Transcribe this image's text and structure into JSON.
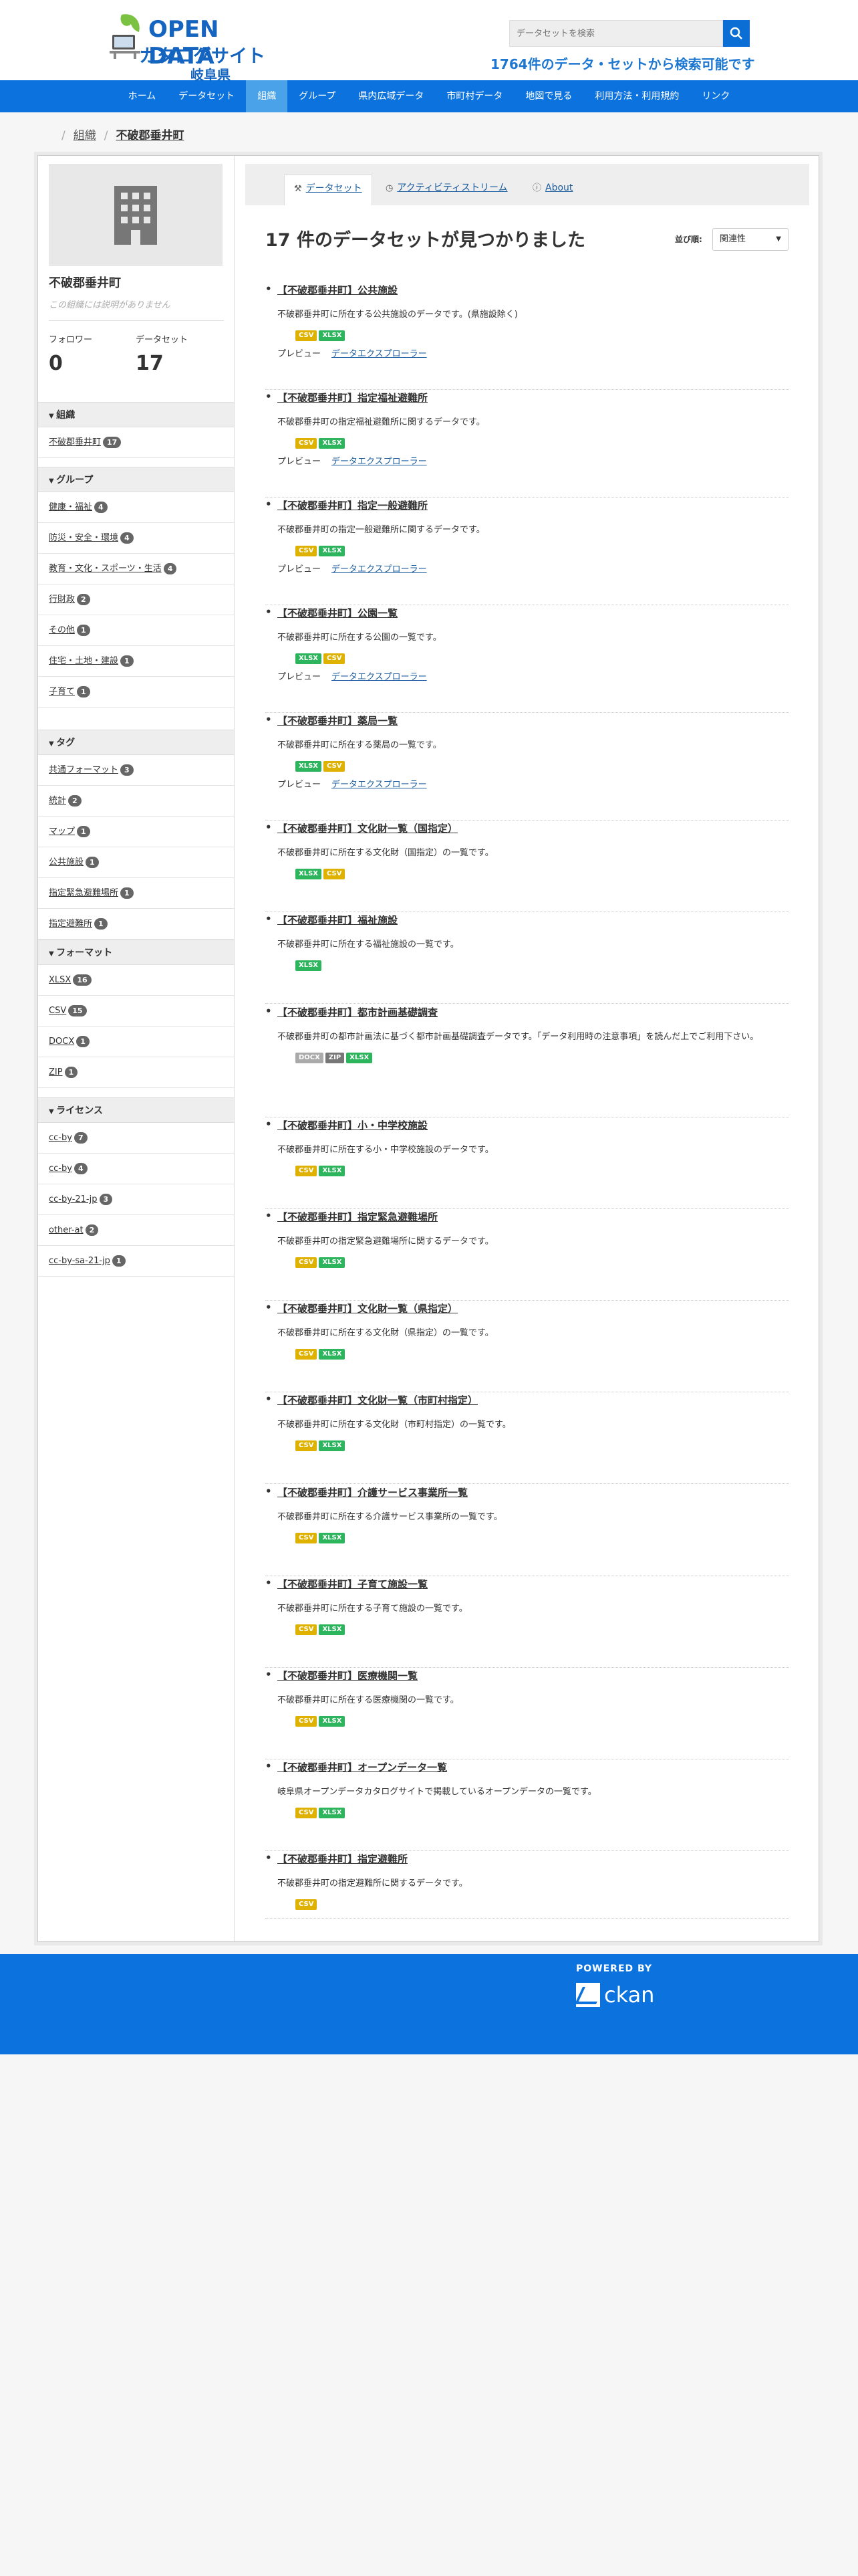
{
  "header": {
    "logo_line1": "OPEN DATA",
    "logo_line2": "カタログサイト",
    "logo_line3": "岐阜県",
    "search_placeholder": "データセットを検索",
    "tagline": "1764件のデータ・セットから検索可能です"
  },
  "nav": [
    "ホーム",
    "データセット",
    "組織",
    "グループ",
    "県内広域データ",
    "市町村データ",
    "地図で見る",
    "利用方法・利用規約",
    "リンク"
  ],
  "nav_active": "組織",
  "breadcrumb": {
    "parent": "組織",
    "current": "不破郡垂井町"
  },
  "org": {
    "name": "不破郡垂井町",
    "description": "この組織には説明がありません",
    "followers_label": "フォロワー",
    "followers": "0",
    "datasets_label": "データセット",
    "datasets": "17"
  },
  "facets": {
    "org": {
      "title": "組織",
      "items": [
        {
          "label": "不破郡垂井町",
          "count": "17"
        }
      ]
    },
    "groups": {
      "title": "グループ",
      "items": [
        {
          "label": "健康・福祉",
          "count": "4"
        },
        {
          "label": "防災・安全・環境",
          "count": "4"
        },
        {
          "label": "教育・文化・スポーツ・生活",
          "count": "4"
        },
        {
          "label": "行財政",
          "count": "2"
        },
        {
          "label": "その他",
          "count": "1"
        },
        {
          "label": "住宅・土地・建設",
          "count": "1"
        },
        {
          "label": "子育て",
          "count": "1"
        }
      ]
    },
    "tags": {
      "title": "タグ",
      "items": [
        {
          "label": "共通フォーマット",
          "count": "3"
        },
        {
          "label": "統計",
          "count": "2"
        },
        {
          "label": "マップ",
          "count": "1"
        },
        {
          "label": "公共施設",
          "count": "1"
        },
        {
          "label": "指定緊急避難場所",
          "count": "1"
        },
        {
          "label": "指定避難所",
          "count": "1"
        }
      ]
    },
    "formats": {
      "title": "フォーマット",
      "items": [
        {
          "label": "XLSX",
          "count": "16"
        },
        {
          "label": "CSV",
          "count": "15"
        },
        {
          "label": "DOCX",
          "count": "1"
        },
        {
          "label": "ZIP",
          "count": "1"
        }
      ]
    },
    "licenses": {
      "title": "ライセンス",
      "items": [
        {
          "label": "cc-by",
          "count": "7"
        },
        {
          "label": "cc-by",
          "count": "4"
        },
        {
          "label": "cc-by-21-jp",
          "count": "3"
        },
        {
          "label": "other-at",
          "count": "2"
        },
        {
          "label": "cc-by-sa-21-jp",
          "count": "1"
        }
      ]
    }
  },
  "tabs": {
    "datasets": "データセット",
    "activity": "アクティビティストリーム",
    "about": "About"
  },
  "results_title": "17 件のデータセットが見つかりました",
  "sort": {
    "label": "並び順:",
    "value": "関連性"
  },
  "preview_label": "プレビュー",
  "explorer_label": "データエクスプローラー",
  "datasets": [
    {
      "title": "【不破郡垂井町】公共施設",
      "notes": "不破郡垂井町に所在する公共施設のデータです。(県施設除く)",
      "res": [
        "CSV",
        "XLSX"
      ],
      "preview": true
    },
    {
      "title": "【不破郡垂井町】指定福祉避難所",
      "notes": "不破郡垂井町の指定福祉避難所に関するデータです。",
      "res": [
        "CSV",
        "XLSX"
      ],
      "preview": true
    },
    {
      "title": "【不破郡垂井町】指定一般避難所",
      "notes": "不破郡垂井町の指定一般避難所に関するデータです。",
      "res": [
        "CSV",
        "XLSX"
      ],
      "preview": true
    },
    {
      "title": "【不破郡垂井町】公園一覧",
      "notes": "不破郡垂井町に所在する公園の一覧です。",
      "res": [
        "XLSX",
        "CSV"
      ],
      "preview": true
    },
    {
      "title": "【不破郡垂井町】薬局一覧",
      "notes": "不破郡垂井町に所在する薬局の一覧です。",
      "res": [
        "XLSX",
        "CSV"
      ],
      "preview": true
    },
    {
      "title": "【不破郡垂井町】文化財一覧（国指定）",
      "notes": "不破郡垂井町に所在する文化財（国指定）の一覧です。",
      "res": [
        "XLSX",
        "CSV"
      ],
      "preview": false
    },
    {
      "title": "【不破郡垂井町】福祉施設",
      "notes": "不破郡垂井町に所在する福祉施設の一覧です。",
      "res": [
        "XLSX"
      ],
      "preview": false
    },
    {
      "title": "【不破郡垂井町】都市計画基礎調査",
      "notes": "不破郡垂井町の都市計画法に基づく都市計画基礎調査データです。「データ利用時の注意事項」を読んだ上でご利用下さい。",
      "res": [
        "DOCX",
        "ZIP",
        "XLSX"
      ],
      "preview": false
    },
    {
      "title": "【不破郡垂井町】小・中学校施設",
      "notes": "不破郡垂井町に所在する小・中学校施設のデータです。",
      "res": [
        "CSV",
        "XLSX"
      ],
      "preview": false
    },
    {
      "title": "【不破郡垂井町】指定緊急避難場所",
      "notes": "不破郡垂井町の指定緊急避難場所に関するデータです。",
      "res": [
        "CSV",
        "XLSX"
      ],
      "preview": false
    },
    {
      "title": "【不破郡垂井町】文化財一覧（県指定）",
      "notes": "不破郡垂井町に所在する文化財（県指定）の一覧です。",
      "res": [
        "CSV",
        "XLSX"
      ],
      "preview": false
    },
    {
      "title": "【不破郡垂井町】文化財一覧（市町村指定）",
      "notes": "不破郡垂井町に所在する文化財（市町村指定）の一覧です。",
      "res": [
        "CSV",
        "XLSX"
      ],
      "preview": false
    },
    {
      "title": "【不破郡垂井町】介護サービス事業所一覧",
      "notes": "不破郡垂井町に所在する介護サービス事業所の一覧です。",
      "res": [
        "CSV",
        "XLSX"
      ],
      "preview": false
    },
    {
      "title": "【不破郡垂井町】子育て施設一覧",
      "notes": "不破郡垂井町に所在する子育て施設の一覧です。",
      "res": [
        "CSV",
        "XLSX"
      ],
      "preview": false
    },
    {
      "title": "【不破郡垂井町】医療機関一覧",
      "notes": "不破郡垂井町に所在する医療機関の一覧です。",
      "res": [
        "CSV",
        "XLSX"
      ],
      "preview": false
    },
    {
      "title": "【不破郡垂井町】オープンデータ一覧",
      "notes": "岐阜県オープンデータカタログサイトで掲載しているオープンデータの一覧です。",
      "res": [
        "CSV",
        "XLSX"
      ],
      "preview": false
    },
    {
      "title": "【不破郡垂井町】指定避難所",
      "notes": "不破郡垂井町の指定避難所に関するデータです。",
      "res": [
        "CSV"
      ],
      "preview": false
    }
  ],
  "footer": {
    "powered": "POWERED BY",
    "ckan": "ckan"
  },
  "colors": {
    "nav": "#0b72de",
    "nav_active": "#4aa3e8",
    "csv": "#dfb100",
    "xlsx": "#2db55d",
    "link": "#1b5c9e"
  }
}
